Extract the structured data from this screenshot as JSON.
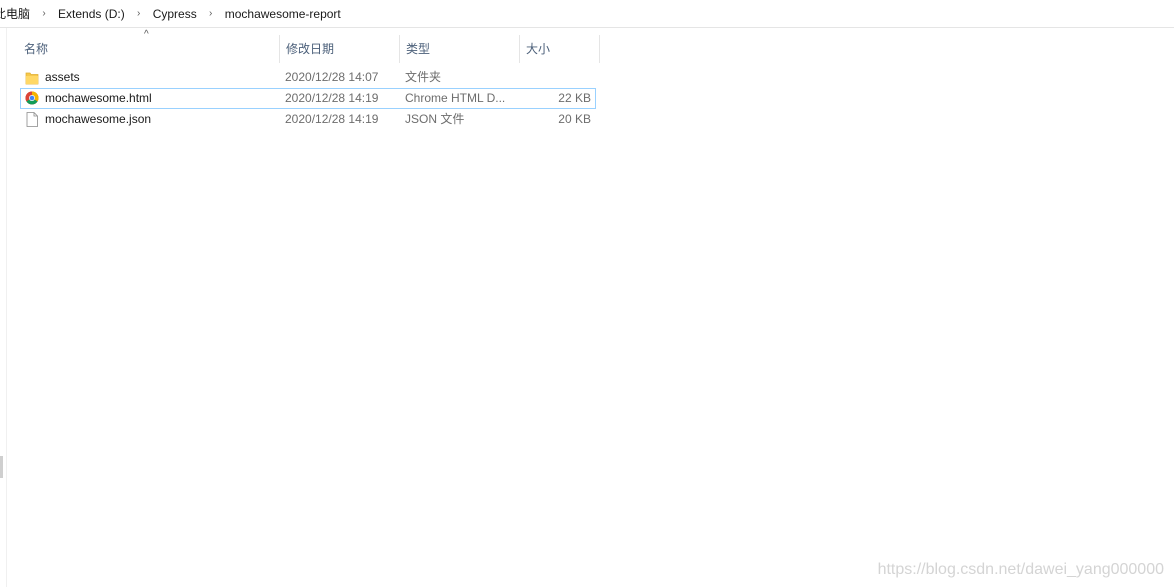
{
  "breadcrumb": {
    "items": [
      {
        "label": "此电脑"
      },
      {
        "label": "Extends (D:)"
      },
      {
        "label": "Cypress"
      },
      {
        "label": "mochawesome-report"
      }
    ]
  },
  "columns": {
    "name": "名称",
    "date": "修改日期",
    "type": "类型",
    "size": "大小",
    "sort_indicator": "^"
  },
  "files": [
    {
      "name": "assets",
      "date": "2020/12/28 14:07",
      "type": "文件夹",
      "size": "",
      "icon": "folder-icon"
    },
    {
      "name": "mochawesome.html",
      "date": "2020/12/28 14:19",
      "type": "Chrome HTML D...",
      "size": "22 KB",
      "icon": "chrome-icon"
    },
    {
      "name": "mochawesome.json",
      "date": "2020/12/28 14:19",
      "type": "JSON 文件",
      "size": "20 KB",
      "icon": "file-icon"
    }
  ],
  "watermark": "https://blog.csdn.net/dawei_yang000000",
  "colors": {
    "selection_border": "#99d1ff",
    "header_text": "#4c607a",
    "folder": "#f5c84c"
  }
}
